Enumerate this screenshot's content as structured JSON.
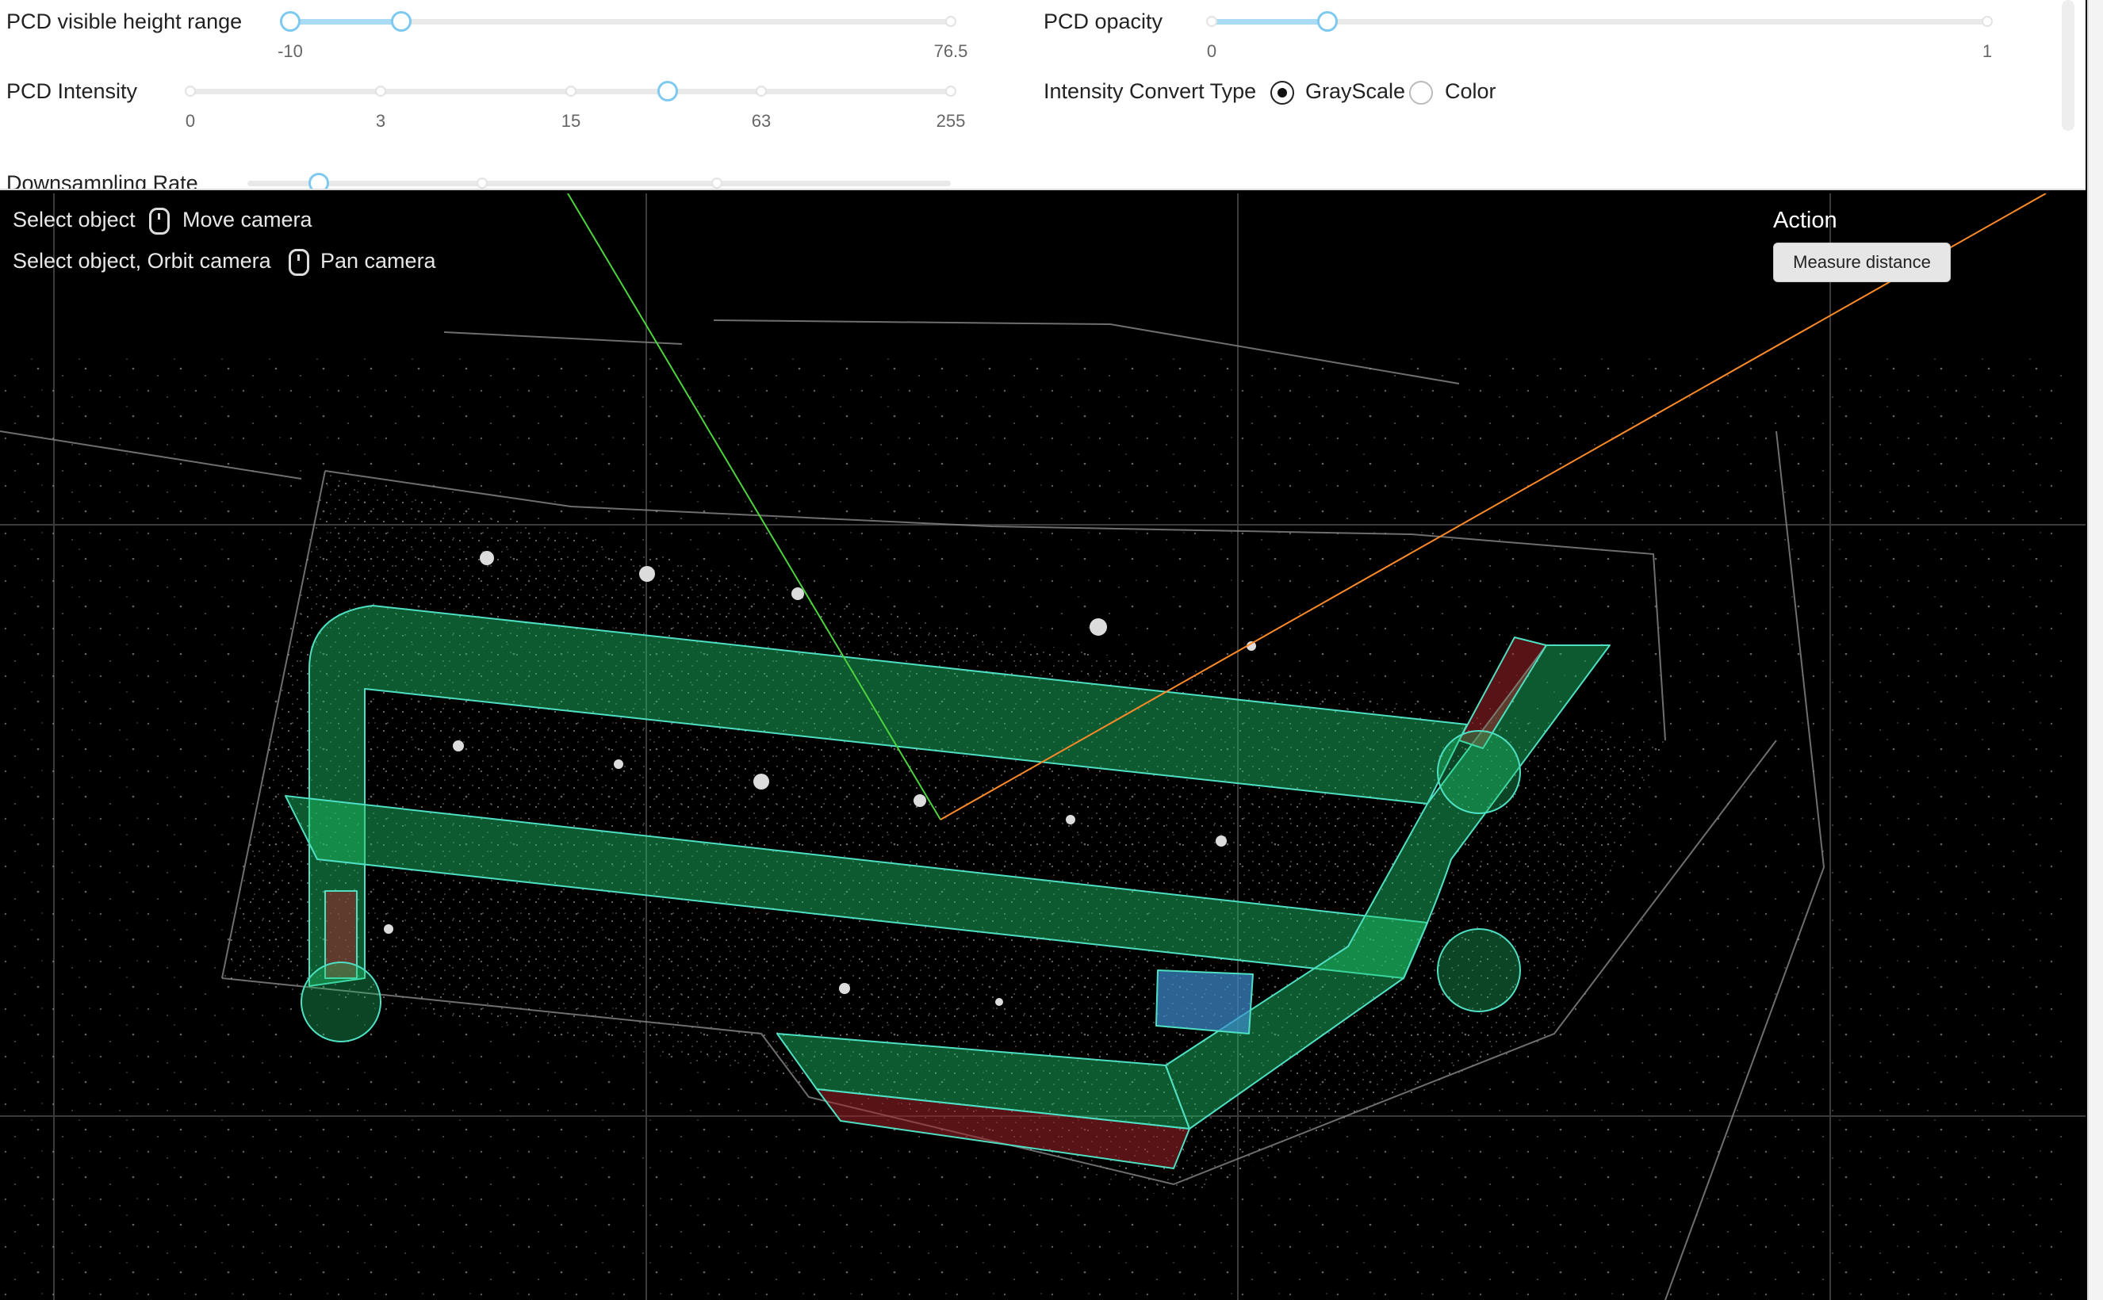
{
  "controls": {
    "height_range": {
      "label": "PCD visible height range",
      "min_label": "-10",
      "max_label": "76.5",
      "value_low_fraction": 0.0,
      "value_high_fraction": 0.17
    },
    "opacity": {
      "label": "PCD opacity",
      "min_label": "0",
      "max_label": "1",
      "value_fraction": 0.15
    },
    "intensity": {
      "label": "PCD Intensity",
      "ticks": [
        "0",
        "3",
        "15",
        "63",
        "255"
      ],
      "value_fraction": 0.63
    },
    "convert_type": {
      "label": "Intensity Convert Type",
      "options": [
        "GrayScale",
        "Color"
      ],
      "selected": "GrayScale"
    },
    "downsampling": {
      "label": "Downsampling Rate",
      "value_fraction": 0.1
    }
  },
  "hints": {
    "line1_left": "Select object",
    "line1_right": "Move camera",
    "line2_left": "Select object, Orbit camera",
    "line2_right": "Pan camera"
  },
  "action": {
    "title": "Action",
    "button_label": "Measure distance"
  },
  "colors": {
    "lane_fill": "#1fc76a",
    "lane_stroke": "#4fe0c4",
    "red_area": "#a0232a",
    "blue_area": "#3d8fd1",
    "x_axis": "#ff8a2a",
    "y_axis": "#4cd43c",
    "grid": "#3c3c3c"
  }
}
